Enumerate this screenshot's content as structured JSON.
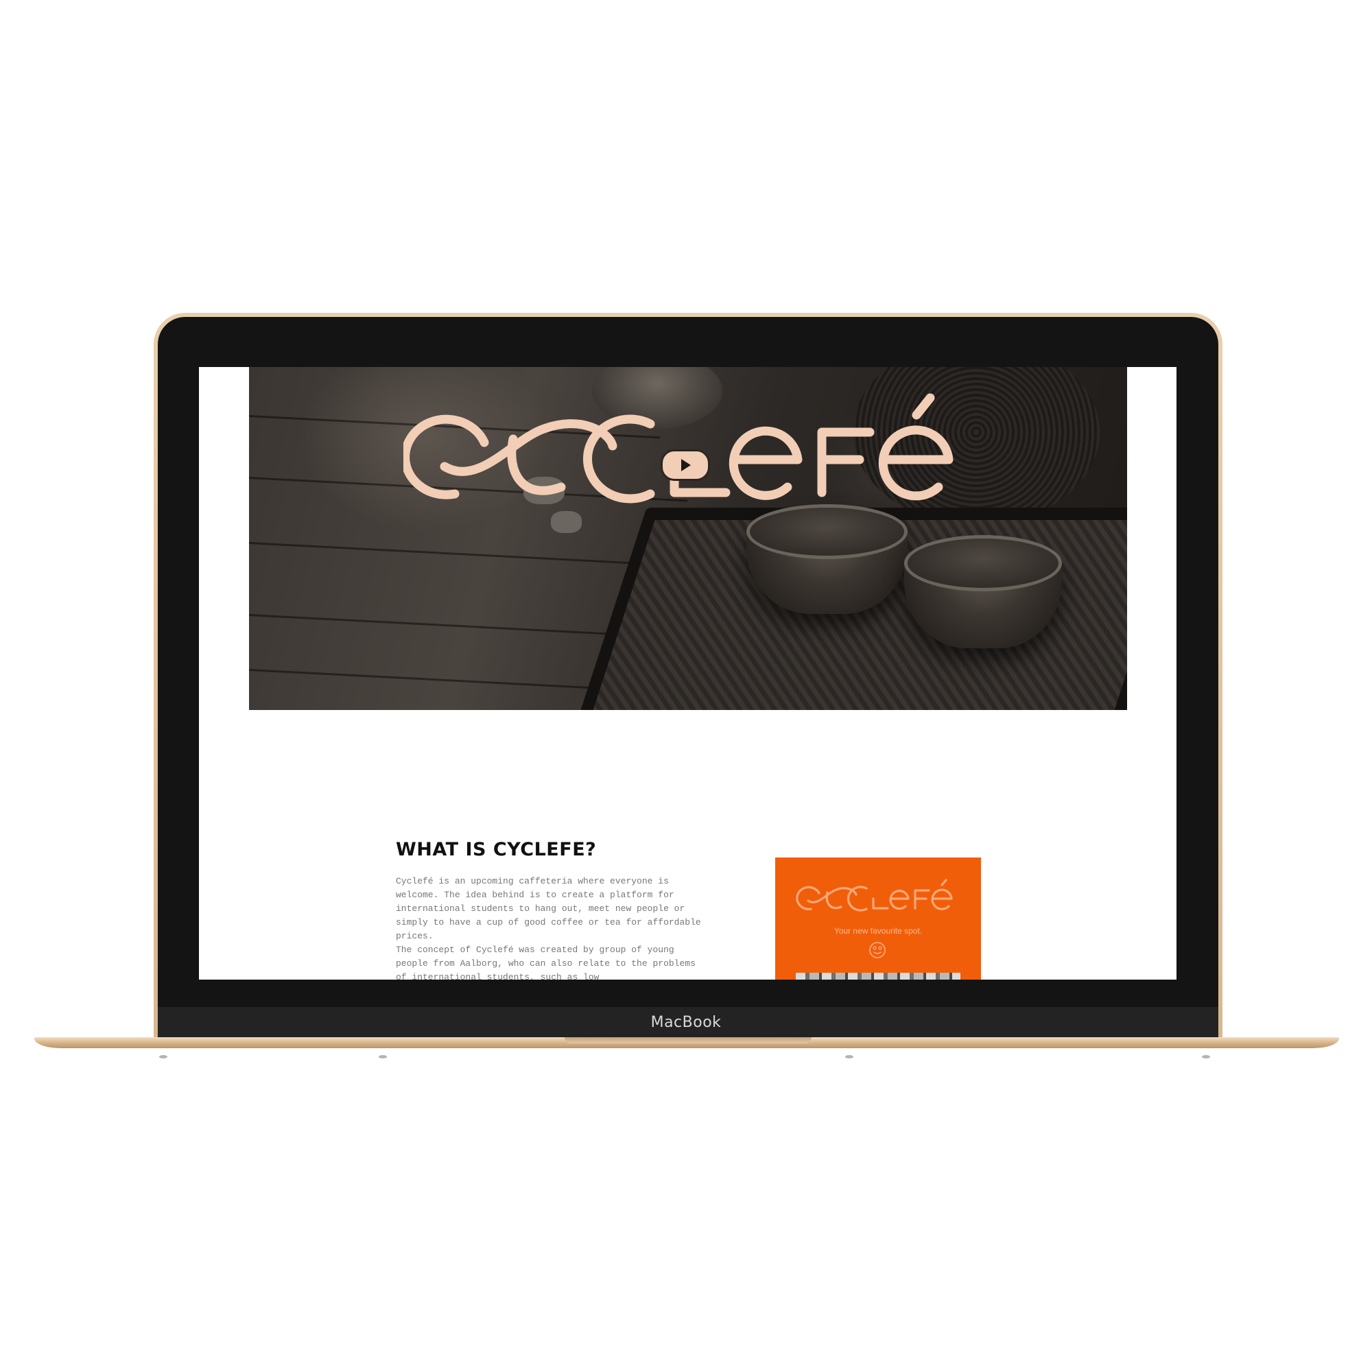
{
  "device": {
    "brand_label": "MacBook"
  },
  "hero": {
    "logo_text": "CYCLEFÉ",
    "play_button": "play-icon"
  },
  "about": {
    "title": "WHAT IS CYCLEFE?",
    "paragraph_1": "Cyclefé is an upcoming caffeteria where everyone is welcome. The idea behind is to create a platform for international students to hang out, meet new people or simply to have a cup of good coffee or tea for affordable prices.",
    "paragraph_2": "The concept of Cyclefé was created by group of young people from Aalborg, who can also relate to the problems of international students, such as low"
  },
  "promo_card": {
    "logo_text": "CYCLEFÉ",
    "tagline": "Your new favourite spot.",
    "icon": "smiley-icon"
  },
  "colors": {
    "accent_orange": "#f15e0a",
    "logo_peach": "#f2ceb6",
    "macbook_gold": "#e3c6a0"
  }
}
